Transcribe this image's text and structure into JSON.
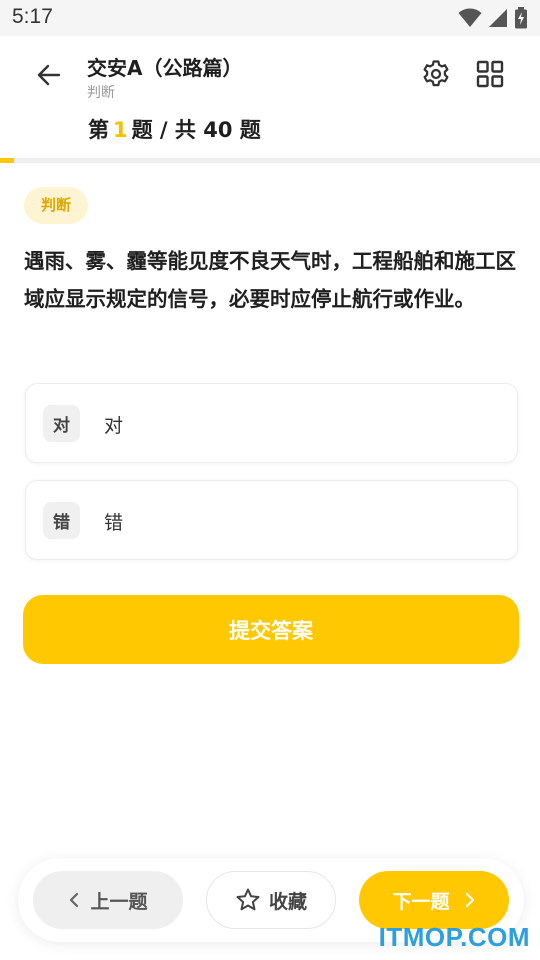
{
  "status": {
    "time": "5:17"
  },
  "header": {
    "title": "交安A（公路篇）",
    "subtitle": "判断",
    "counter_prefix": "第",
    "current": "1",
    "counter_suffix": "题 / 共 40 题"
  },
  "progress": {
    "fraction": 0.025
  },
  "question": {
    "badge": "判断",
    "text": "遇雨、雾、霾等能见度不良天气时，工程船舶和施工区域应显示规定的信号，必要时应停止航行或作业。"
  },
  "options": [
    {
      "key": "对",
      "label": "对"
    },
    {
      "key": "错",
      "label": "错"
    }
  ],
  "submit_label": "提交答案",
  "bottom": {
    "prev_label": "上一题",
    "fav_label": "收藏",
    "next_label": "下一题"
  },
  "watermark": "ITMOP.COM",
  "colors": {
    "accent": "#ffc800",
    "badge_bg": "#fff4d1",
    "watermark": "#2c9fe0"
  },
  "icons": [
    "wifi-icon",
    "signal-icon",
    "battery-icon",
    "back-arrow-icon",
    "gear-icon",
    "grid-icon",
    "chevron-left-icon",
    "star-icon",
    "chevron-right-icon"
  ]
}
